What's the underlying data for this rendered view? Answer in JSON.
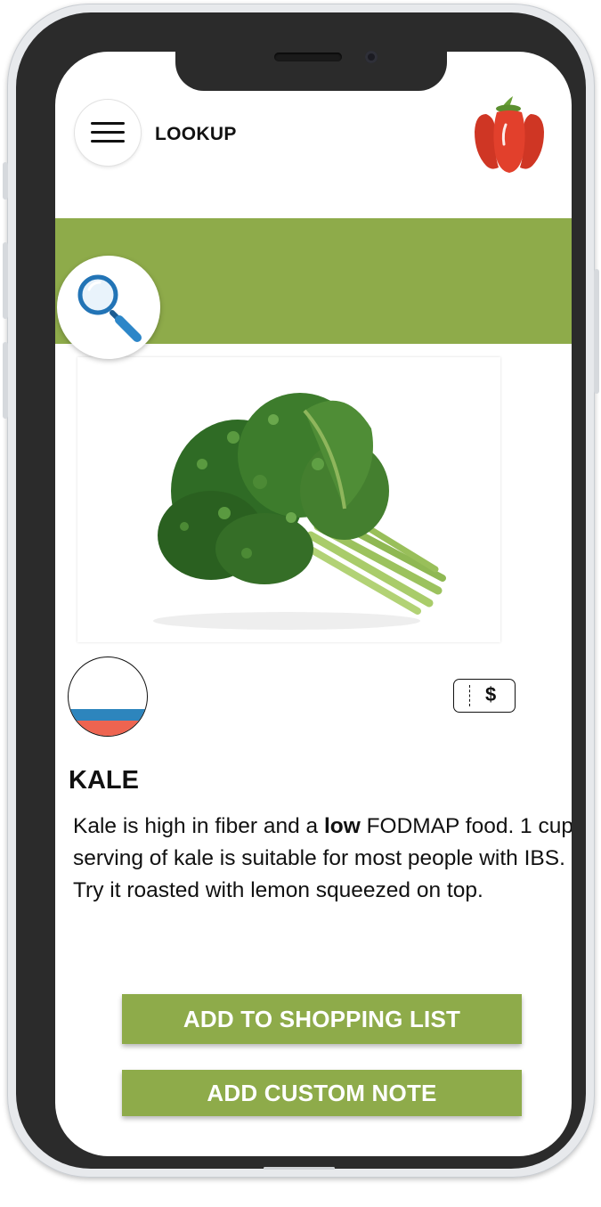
{
  "header": {
    "title": "LOOKUP",
    "menu_icon": "hamburger-menu-icon",
    "logo_icon": "red-pepper-logo"
  },
  "search": {
    "icon": "magnifying-glass-icon"
  },
  "food": {
    "image": "kale-bunch-photo",
    "name": "KALE",
    "description": {
      "part1": "Kale is high in fiber and a ",
      "emphasis": "low",
      "part2": " FODMAP food. 1 cup serving of kale is suitable for most people with IBS. Try it roasted with lemon squeezed on top."
    },
    "price_symbol": "$"
  },
  "actions": {
    "add_to_shopping_list": "ADD TO SHOPPING LIST",
    "add_custom_note": "ADD CUSTOM NOTE"
  },
  "colors": {
    "accent_green": "#8eab4a",
    "gauge_blue": "#2d85bd",
    "gauge_red": "#ee6450",
    "logo_red": "#e2402c"
  }
}
